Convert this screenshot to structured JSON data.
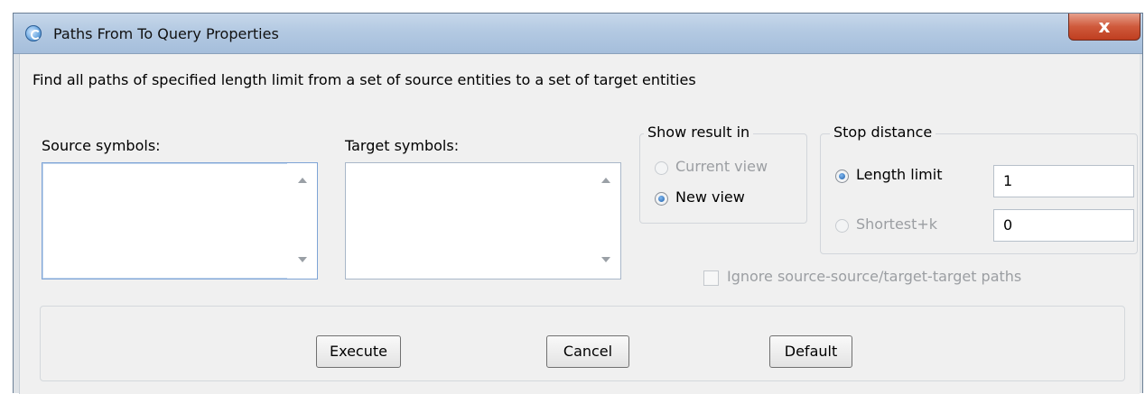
{
  "window": {
    "title": "Paths From To Query Properties",
    "close_glyph": "x"
  },
  "description": "Find all paths of specified length limit from a set of source entities to a set of target entities",
  "source": {
    "label": "Source symbols:",
    "value": ""
  },
  "target": {
    "label": "Target symbols:",
    "value": ""
  },
  "show_result": {
    "legend": "Show result in",
    "options": [
      {
        "label": "Current view",
        "selected": false,
        "enabled": false
      },
      {
        "label": "New view",
        "selected": true,
        "enabled": true
      }
    ]
  },
  "stop_distance": {
    "legend": "Stop distance",
    "length_limit": {
      "label": "Length limit",
      "value": "1",
      "selected": true
    },
    "shortest_k": {
      "label": "Shortest+k",
      "value": "0",
      "selected": false
    }
  },
  "ignore_paths": {
    "label": "Ignore source-source/target-target paths",
    "checked": false,
    "enabled": false
  },
  "buttons": {
    "execute": "Execute",
    "cancel": "Cancel",
    "default": "Default"
  },
  "icons": {
    "app": "app-icon",
    "close": "close-icon",
    "scroll_up": "scroll-up-arrow-icon",
    "scroll_down": "scroll-down-arrow-icon"
  }
}
